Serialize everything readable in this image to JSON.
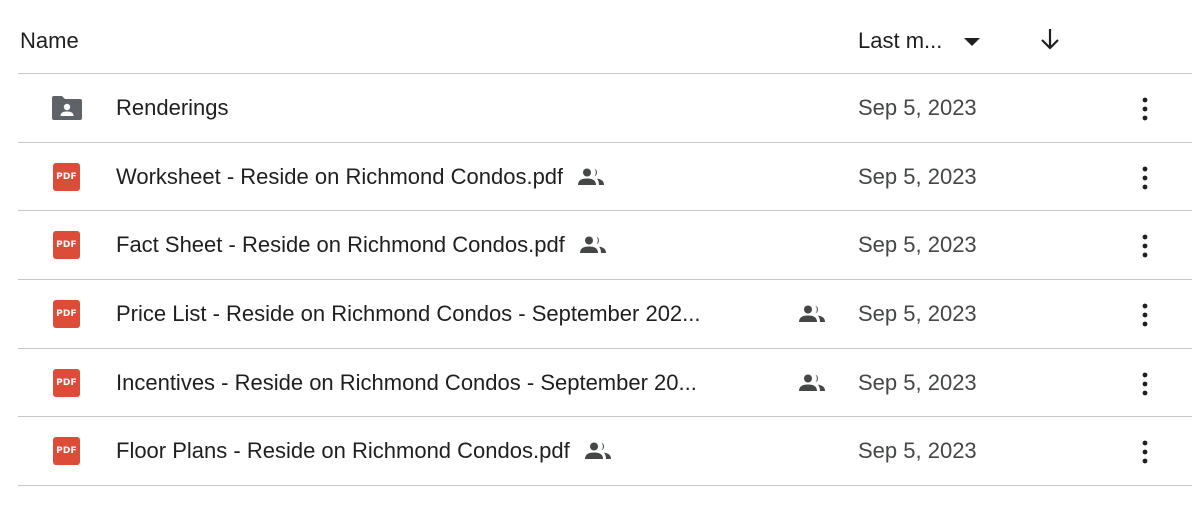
{
  "header": {
    "name_label": "Name",
    "modified_label": "Last m...",
    "sort_direction_icon": "arrow-down-icon"
  },
  "files": [
    {
      "type": "shared-folder",
      "icon": "shared-folder-icon",
      "name": "Renderings",
      "shared": false,
      "modified": "Sep 5, 2023"
    },
    {
      "type": "pdf",
      "icon": "pdf-icon",
      "icon_text": "PDF",
      "name": "Worksheet - Reside on Richmond Condos.pdf",
      "shared": true,
      "modified": "Sep 5, 2023"
    },
    {
      "type": "pdf",
      "icon": "pdf-icon",
      "icon_text": "PDF",
      "name": "Fact Sheet - Reside on Richmond Condos.pdf",
      "shared": true,
      "modified": "Sep 5, 2023"
    },
    {
      "type": "pdf",
      "icon": "pdf-icon",
      "icon_text": "PDF",
      "name": "Price List - Reside on Richmond Condos - September 202...",
      "shared": true,
      "modified": "Sep 5, 2023"
    },
    {
      "type": "pdf",
      "icon": "pdf-icon",
      "icon_text": "PDF",
      "name": "Incentives - Reside on Richmond Condos - September 20...",
      "shared": true,
      "modified": "Sep 5, 2023"
    },
    {
      "type": "pdf",
      "icon": "pdf-icon",
      "icon_text": "PDF",
      "name": "Floor Plans - Reside on Richmond Condos.pdf",
      "shared": true,
      "modified": "Sep 5, 2023"
    }
  ],
  "colors": {
    "pdf_red": "#dd4b39",
    "folder_gray": "#5f6368",
    "divider": "#c7c7c7",
    "text": "#1f1f1f",
    "secondary_text": "#444746"
  }
}
